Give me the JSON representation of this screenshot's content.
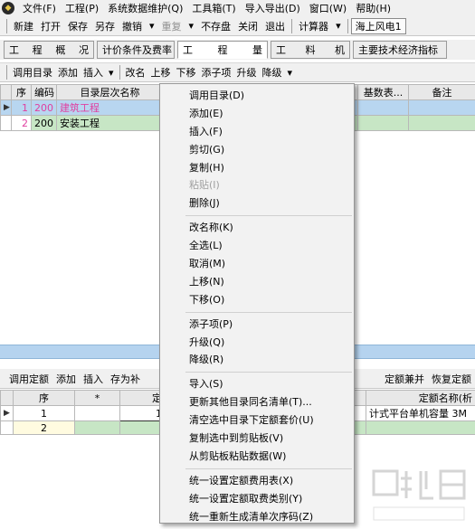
{
  "menubar": {
    "app_icon": "app-logo-icon",
    "items": [
      "文件(F)",
      "工程(P)",
      "系统数据维护(Q)",
      "工具箱(T)",
      "导入导出(D)",
      "窗口(W)",
      "帮助(H)"
    ]
  },
  "toolbar": {
    "new": "新建",
    "open": "打开",
    "save": "保存",
    "save_as": "另存",
    "undo": "撤销",
    "redo": "重复",
    "no_save": "不存盘",
    "close": "关闭",
    "exit": "退出",
    "calculator": "计算器",
    "project_name": "海上风电1"
  },
  "tabs": [
    {
      "label_parts": [
        "工",
        "程",
        "概",
        "况"
      ],
      "active": false
    },
    {
      "label": "计价条件及费率",
      "active": false
    },
    {
      "label_parts": [
        "工",
        "程",
        "量"
      ],
      "active": true
    },
    {
      "label_parts": [
        "工",
        "料",
        "机"
      ],
      "active": false
    },
    {
      "label": "主要技术经济指标",
      "active": false
    }
  ],
  "subtoolbar": {
    "call_catalog": "调用目录",
    "add": "添加",
    "insert": "插入",
    "rename": "改名",
    "move_up": "上移",
    "move_down": "下移",
    "add_child": "添子项",
    "promote": "升级",
    "demote": "降级"
  },
  "upper_grid": {
    "headers": [
      "序",
      "编码",
      "目录层次名称",
      "基数表...",
      "备注"
    ],
    "rows": [
      {
        "seq": "1",
        "code": "200",
        "name": "建筑工程"
      },
      {
        "seq": "2",
        "code": "200",
        "name": "安装工程"
      }
    ]
  },
  "lower_toolbar": {
    "call_quota": "调用定额",
    "add": "添加",
    "insert": "插入",
    "save_as": "存为补",
    "merge": "定额兼并",
    "restore": "恢复定额"
  },
  "lower_grid": {
    "headers": [
      "序",
      "*",
      "定",
      "定额名称(析"
    ],
    "rows": [
      {
        "seq": "1",
        "star": "",
        "code": "1",
        "name": "计式平台单机容量 3M"
      },
      {
        "seq": "2",
        "star": "",
        "code": "",
        "name": ""
      }
    ]
  },
  "context_menu": {
    "groups": [
      [
        {
          "label": "调用目录(D)",
          "enabled": true
        },
        {
          "label": "添加(E)",
          "enabled": true
        },
        {
          "label": "插入(F)",
          "enabled": true
        },
        {
          "label": "剪切(G)",
          "enabled": true
        },
        {
          "label": "复制(H)",
          "enabled": true
        },
        {
          "label": "粘贴(I)",
          "enabled": false
        },
        {
          "label": "删除(J)",
          "enabled": true
        }
      ],
      [
        {
          "label": "改名称(K)",
          "enabled": true
        },
        {
          "label": "全选(L)",
          "enabled": true
        },
        {
          "label": "取消(M)",
          "enabled": true
        },
        {
          "label": "上移(N)",
          "enabled": true
        },
        {
          "label": "下移(O)",
          "enabled": true
        }
      ],
      [
        {
          "label": "添子项(P)",
          "enabled": true
        },
        {
          "label": "升级(Q)",
          "enabled": true
        },
        {
          "label": "降级(R)",
          "enabled": true
        }
      ],
      [
        {
          "label": "导入(S)",
          "enabled": true
        },
        {
          "label": "更新其他目录同名清单(T)...",
          "enabled": true
        },
        {
          "label": "清空选中目录下定额套价(U)",
          "enabled": true
        },
        {
          "label": "复制选中到剪贴板(V)",
          "enabled": true
        },
        {
          "label": "从剪贴板粘贴数据(W)",
          "enabled": true
        }
      ],
      [
        {
          "label": "统一设置定额费用表(X)",
          "enabled": true
        },
        {
          "label": "统一设置定额取费类别(Y)",
          "enabled": true
        },
        {
          "label": "统一重新生成清单次序码(Z)",
          "enabled": true
        }
      ]
    ]
  },
  "colors": {
    "selected_row": "#b8d6f0",
    "green_row": "#c7e6c5",
    "pink_text": "#e040a0",
    "divider_bar": "#b5d3ef"
  }
}
